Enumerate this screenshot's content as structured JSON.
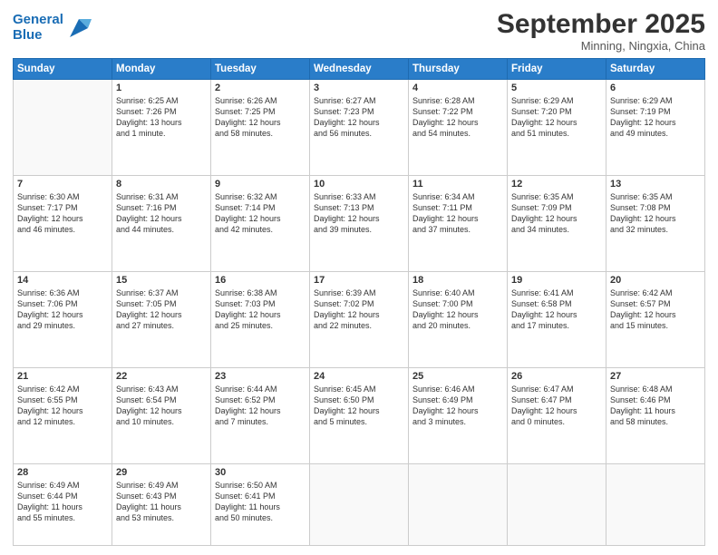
{
  "header": {
    "logo_line1": "General",
    "logo_line2": "Blue",
    "title": "September 2025",
    "subtitle": "Minning, Ningxia, China"
  },
  "weekdays": [
    "Sunday",
    "Monday",
    "Tuesday",
    "Wednesday",
    "Thursday",
    "Friday",
    "Saturday"
  ],
  "weeks": [
    [
      {
        "day": "",
        "text": ""
      },
      {
        "day": "1",
        "text": "Sunrise: 6:25 AM\nSunset: 7:26 PM\nDaylight: 13 hours\nand 1 minute."
      },
      {
        "day": "2",
        "text": "Sunrise: 6:26 AM\nSunset: 7:25 PM\nDaylight: 12 hours\nand 58 minutes."
      },
      {
        "day": "3",
        "text": "Sunrise: 6:27 AM\nSunset: 7:23 PM\nDaylight: 12 hours\nand 56 minutes."
      },
      {
        "day": "4",
        "text": "Sunrise: 6:28 AM\nSunset: 7:22 PM\nDaylight: 12 hours\nand 54 minutes."
      },
      {
        "day": "5",
        "text": "Sunrise: 6:29 AM\nSunset: 7:20 PM\nDaylight: 12 hours\nand 51 minutes."
      },
      {
        "day": "6",
        "text": "Sunrise: 6:29 AM\nSunset: 7:19 PM\nDaylight: 12 hours\nand 49 minutes."
      }
    ],
    [
      {
        "day": "7",
        "text": "Sunrise: 6:30 AM\nSunset: 7:17 PM\nDaylight: 12 hours\nand 46 minutes."
      },
      {
        "day": "8",
        "text": "Sunrise: 6:31 AM\nSunset: 7:16 PM\nDaylight: 12 hours\nand 44 minutes."
      },
      {
        "day": "9",
        "text": "Sunrise: 6:32 AM\nSunset: 7:14 PM\nDaylight: 12 hours\nand 42 minutes."
      },
      {
        "day": "10",
        "text": "Sunrise: 6:33 AM\nSunset: 7:13 PM\nDaylight: 12 hours\nand 39 minutes."
      },
      {
        "day": "11",
        "text": "Sunrise: 6:34 AM\nSunset: 7:11 PM\nDaylight: 12 hours\nand 37 minutes."
      },
      {
        "day": "12",
        "text": "Sunrise: 6:35 AM\nSunset: 7:09 PM\nDaylight: 12 hours\nand 34 minutes."
      },
      {
        "day": "13",
        "text": "Sunrise: 6:35 AM\nSunset: 7:08 PM\nDaylight: 12 hours\nand 32 minutes."
      }
    ],
    [
      {
        "day": "14",
        "text": "Sunrise: 6:36 AM\nSunset: 7:06 PM\nDaylight: 12 hours\nand 29 minutes."
      },
      {
        "day": "15",
        "text": "Sunrise: 6:37 AM\nSunset: 7:05 PM\nDaylight: 12 hours\nand 27 minutes."
      },
      {
        "day": "16",
        "text": "Sunrise: 6:38 AM\nSunset: 7:03 PM\nDaylight: 12 hours\nand 25 minutes."
      },
      {
        "day": "17",
        "text": "Sunrise: 6:39 AM\nSunset: 7:02 PM\nDaylight: 12 hours\nand 22 minutes."
      },
      {
        "day": "18",
        "text": "Sunrise: 6:40 AM\nSunset: 7:00 PM\nDaylight: 12 hours\nand 20 minutes."
      },
      {
        "day": "19",
        "text": "Sunrise: 6:41 AM\nSunset: 6:58 PM\nDaylight: 12 hours\nand 17 minutes."
      },
      {
        "day": "20",
        "text": "Sunrise: 6:42 AM\nSunset: 6:57 PM\nDaylight: 12 hours\nand 15 minutes."
      }
    ],
    [
      {
        "day": "21",
        "text": "Sunrise: 6:42 AM\nSunset: 6:55 PM\nDaylight: 12 hours\nand 12 minutes."
      },
      {
        "day": "22",
        "text": "Sunrise: 6:43 AM\nSunset: 6:54 PM\nDaylight: 12 hours\nand 10 minutes."
      },
      {
        "day": "23",
        "text": "Sunrise: 6:44 AM\nSunset: 6:52 PM\nDaylight: 12 hours\nand 7 minutes."
      },
      {
        "day": "24",
        "text": "Sunrise: 6:45 AM\nSunset: 6:50 PM\nDaylight: 12 hours\nand 5 minutes."
      },
      {
        "day": "25",
        "text": "Sunrise: 6:46 AM\nSunset: 6:49 PM\nDaylight: 12 hours\nand 3 minutes."
      },
      {
        "day": "26",
        "text": "Sunrise: 6:47 AM\nSunset: 6:47 PM\nDaylight: 12 hours\nand 0 minutes."
      },
      {
        "day": "27",
        "text": "Sunrise: 6:48 AM\nSunset: 6:46 PM\nDaylight: 11 hours\nand 58 minutes."
      }
    ],
    [
      {
        "day": "28",
        "text": "Sunrise: 6:49 AM\nSunset: 6:44 PM\nDaylight: 11 hours\nand 55 minutes."
      },
      {
        "day": "29",
        "text": "Sunrise: 6:49 AM\nSunset: 6:43 PM\nDaylight: 11 hours\nand 53 minutes."
      },
      {
        "day": "30",
        "text": "Sunrise: 6:50 AM\nSunset: 6:41 PM\nDaylight: 11 hours\nand 50 minutes."
      },
      {
        "day": "",
        "text": ""
      },
      {
        "day": "",
        "text": ""
      },
      {
        "day": "",
        "text": ""
      },
      {
        "day": "",
        "text": ""
      }
    ]
  ]
}
